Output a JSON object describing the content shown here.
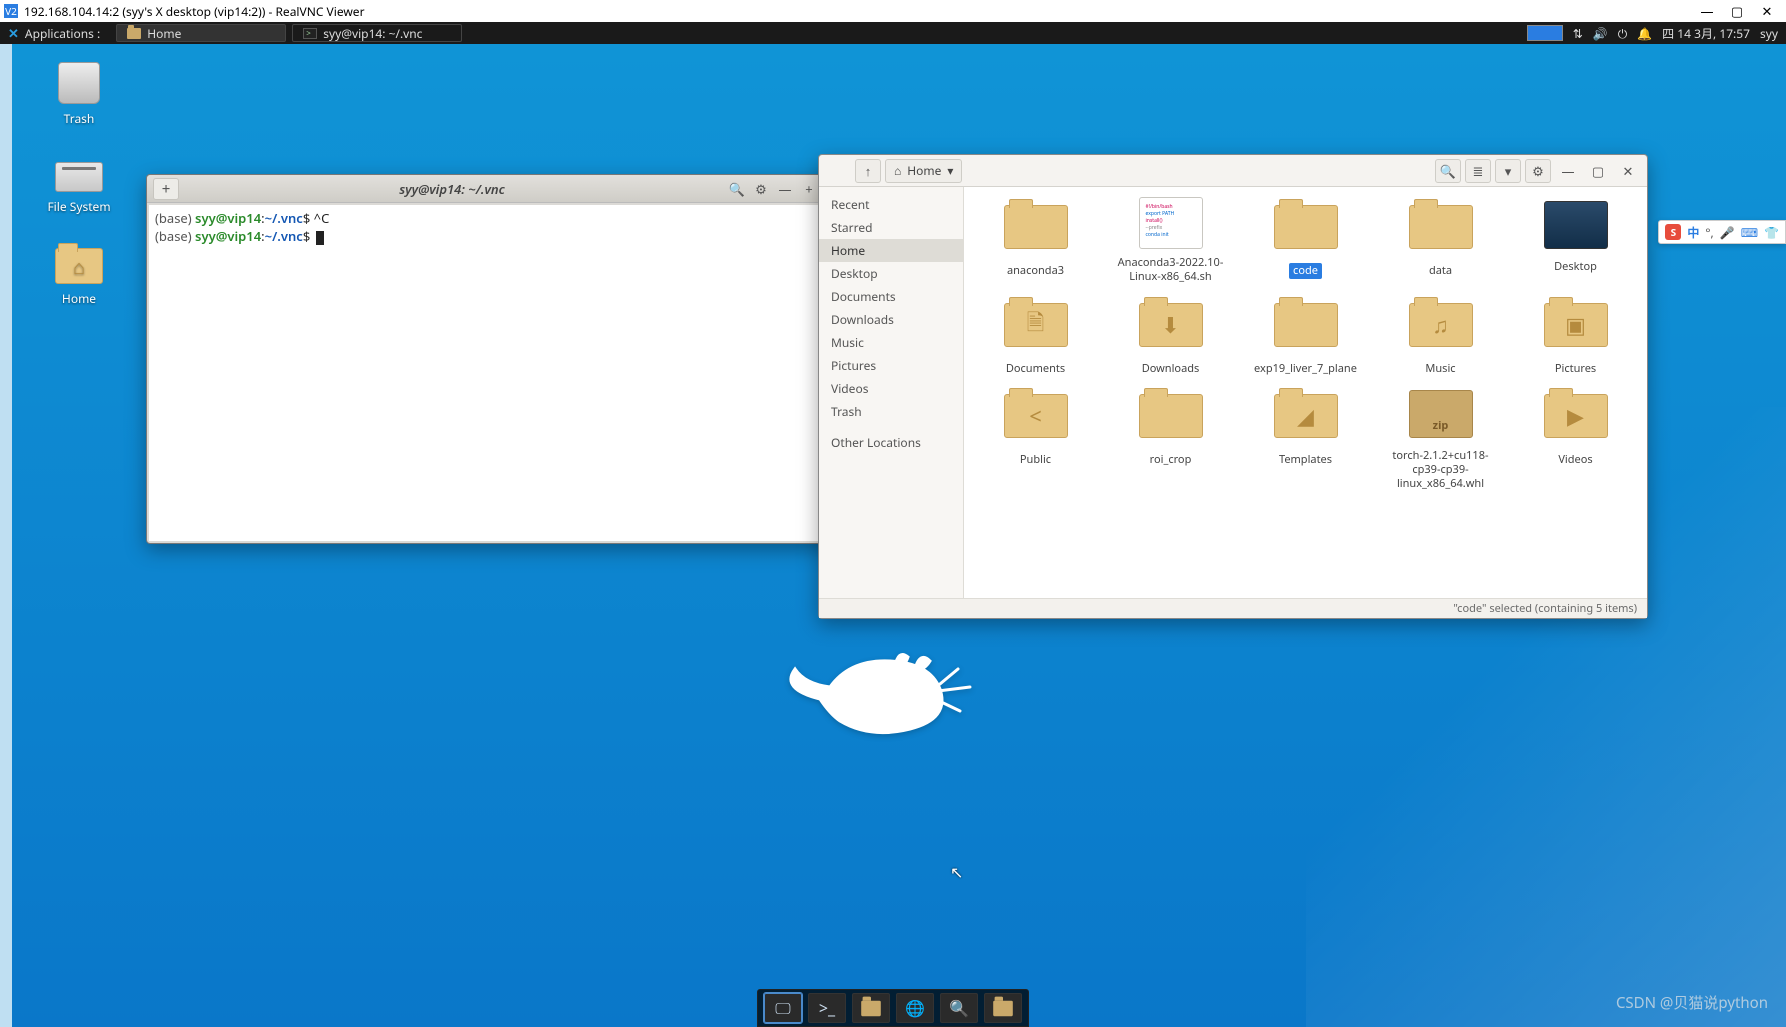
{
  "outer_window": {
    "title": "192.168.104.14:2 (syy's X desktop (vip14:2)) - RealVNC Viewer",
    "min": "—",
    "max": "▢",
    "close": "✕"
  },
  "panel": {
    "apps_label": "Applications :",
    "task_home": "Home",
    "task_terminal": "syy@vip14: ~/.vnc",
    "clock": "四 14 3月, 17:57",
    "user": "syy"
  },
  "desktop_icons": {
    "trash": "Trash",
    "filesystem": "File System",
    "home": "Home"
  },
  "terminal": {
    "title": "syy@vip14: ~/.vnc",
    "plus": "+",
    "search": "🔍",
    "menu": "☰",
    "min": "—",
    "max": "+",
    "close": "✕",
    "line1_env": "(base) ",
    "line1_user": "syy@vip14",
    "line1_sep": ":",
    "line1_path": "~/.vnc",
    "line1_tail": "$ ^C",
    "line2_env": "(base) ",
    "line2_user": "syy@vip14",
    "line2_sep": ":",
    "line2_path": "~/.vnc",
    "line2_tail": "$ "
  },
  "filemgr": {
    "back": "←",
    "fwd": "→",
    "up": "↑",
    "crumb_home": "Home",
    "crumb_dd": "▾",
    "search": "🔍",
    "viewlist": "≣",
    "viewdd": "▾",
    "gear": "⚙",
    "min": "—",
    "max": "▢",
    "close": "✕",
    "sidebar": {
      "recent": "Recent",
      "starred": "Starred",
      "home": "Home",
      "desktop": "Desktop",
      "documents": "Documents",
      "downloads": "Downloads",
      "music": "Music",
      "pictures": "Pictures",
      "videos": "Videos",
      "trash": "Trash",
      "other": "Other Locations"
    },
    "items": [
      {
        "label": "anaconda3",
        "type": "folder"
      },
      {
        "label": "Anaconda3-2022.10-Linux-x86_64.sh",
        "type": "script"
      },
      {
        "label": "code",
        "type": "folder",
        "selected": true
      },
      {
        "label": "data",
        "type": "folder"
      },
      {
        "label": "Desktop",
        "type": "desktop"
      },
      {
        "label": "Documents",
        "type": "folder",
        "glyph": "🗎"
      },
      {
        "label": "Downloads",
        "type": "folder",
        "glyph": "⬇"
      },
      {
        "label": "exp19_liver_7_plane",
        "type": "folder"
      },
      {
        "label": "Music",
        "type": "folder",
        "glyph": "♫"
      },
      {
        "label": "Pictures",
        "type": "folder",
        "glyph": "▣"
      },
      {
        "label": "Public",
        "type": "folder",
        "glyph": "<"
      },
      {
        "label": "roi_crop",
        "type": "folder"
      },
      {
        "label": "Templates",
        "type": "folder",
        "glyph": "◢"
      },
      {
        "label": "torch-2.1.2+cu118-cp39-cp39-linux_x86_64.whl",
        "type": "zip"
      },
      {
        "label": "Videos",
        "type": "folder",
        "glyph": "▶"
      }
    ],
    "status": "\"code\" selected (containing 5 items)"
  },
  "ime": {
    "zhong": "中"
  },
  "watermark": "CSDN @贝猫说python",
  "dock": {
    "btns": [
      "show-desktop",
      "terminal",
      "files",
      "web",
      "search",
      "folder"
    ]
  }
}
